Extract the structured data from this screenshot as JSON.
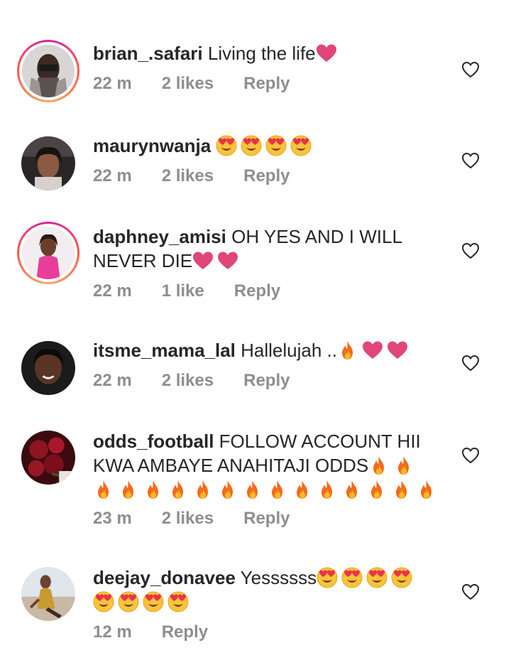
{
  "comments": [
    {
      "username": "brian_.safari",
      "text": "Living the life",
      "emojis": [
        "heart"
      ],
      "time": "22 m",
      "likes": "2 likes",
      "reply": "Reply",
      "story_ring": true
    },
    {
      "username": "maurynwanja",
      "text": "",
      "emojis": [
        "heart-eyes",
        "heart-eyes",
        "heart-eyes",
        "heart-eyes"
      ],
      "time": "22 m",
      "likes": "2 likes",
      "reply": "Reply",
      "story_ring": false
    },
    {
      "username": "daphney_amisi",
      "text": "OH YES AND I WILL",
      "text_line2": "NEVER DIE",
      "emojis": [
        "heart",
        "heart"
      ],
      "time": "22 m",
      "likes": "1 like",
      "reply": "Reply",
      "story_ring": true
    },
    {
      "username": "itsme_mama_lal",
      "text": "Hallelujah ..",
      "emojis": [
        "fire",
        "heart",
        "heart"
      ],
      "time": "22 m",
      "likes": "2 likes",
      "reply": "Reply",
      "story_ring": false
    },
    {
      "username": "odds_football",
      "text": "FOLLOW ACCOUNT HII",
      "text_line2": "KWA AMBAYE ANAHITAJI ODDS",
      "emojis": [
        "fire",
        "fire"
      ],
      "emojis_line3": [
        "fire",
        "fire",
        "fire",
        "fire",
        "fire",
        "fire",
        "fire",
        "fire",
        "fire",
        "fire",
        "fire",
        "fire",
        "fire",
        "fire"
      ],
      "time": "23 m",
      "likes": "2 likes",
      "reply": "Reply",
      "story_ring": false
    },
    {
      "username": "deejay_donavee",
      "text": "Yessssss",
      "emojis": [
        "heart-eyes",
        "heart-eyes",
        "heart-eyes",
        "heart-eyes"
      ],
      "emojis_line2": [
        "heart-eyes",
        "heart-eyes",
        "heart-eyes",
        "heart-eyes"
      ],
      "time": "12 m",
      "reply": "Reply",
      "story_ring": false
    }
  ],
  "icons": {
    "like": "heart-outline-icon"
  },
  "colors": {
    "text": "#262626",
    "meta": "#8e8e8e",
    "heart": "#e0457b",
    "story_ring_start": "#d6249f",
    "story_ring_end": "#f8a95c"
  }
}
